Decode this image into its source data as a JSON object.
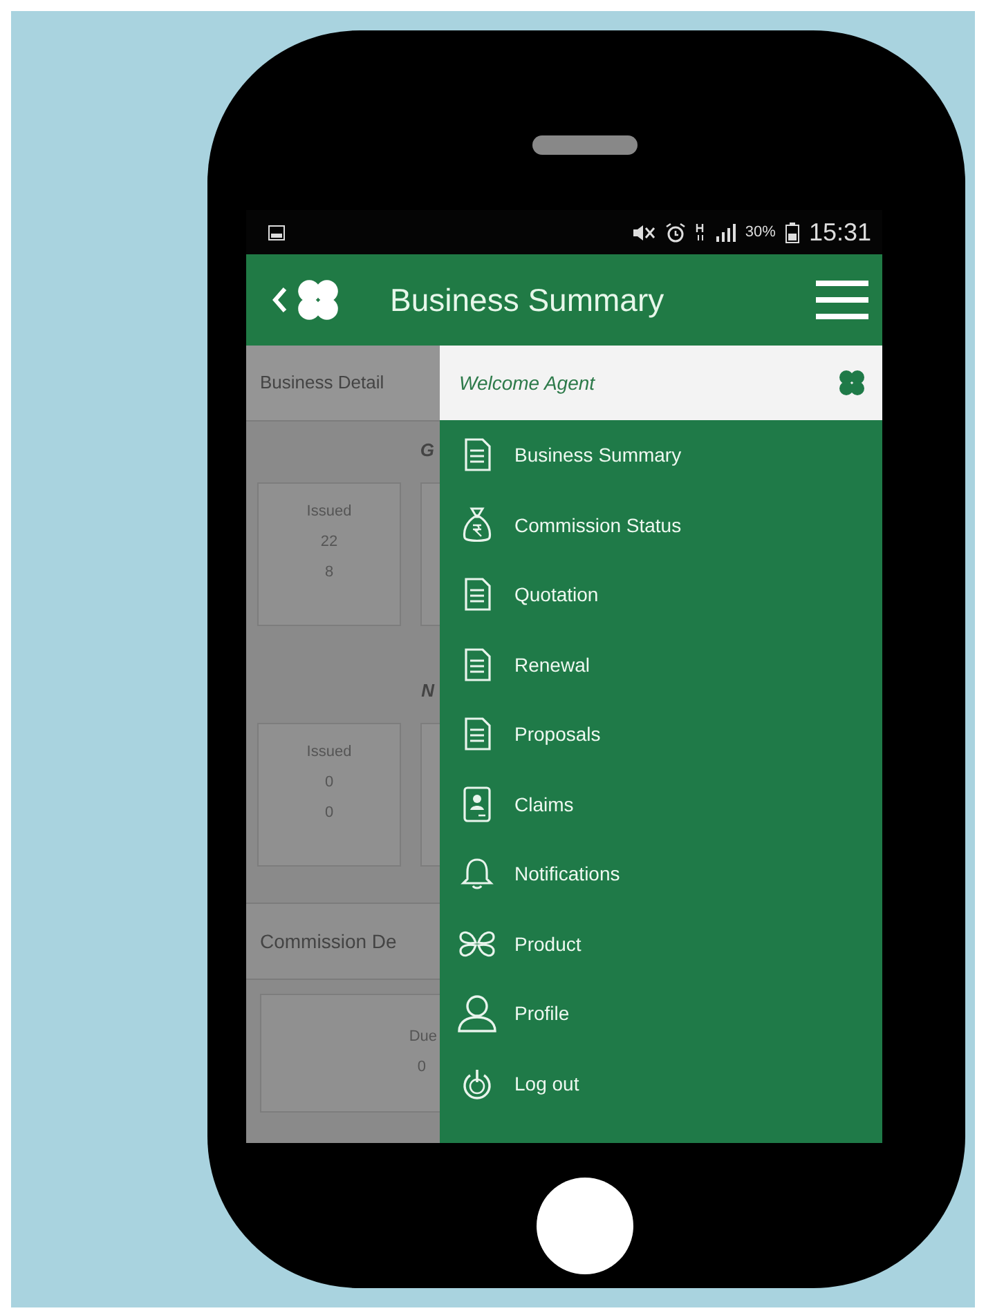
{
  "status_bar": {
    "battery": "30%",
    "time": "15:31"
  },
  "header": {
    "title": "Business Summary"
  },
  "background_screen": {
    "section_title": "Business Detail",
    "groups": [
      {
        "heading": "G",
        "card": {
          "label": "Issued",
          "values": [
            "22",
            "8"
          ]
        }
      },
      {
        "heading": "N",
        "card": {
          "label": "Issued",
          "values": [
            "0",
            "0"
          ]
        }
      }
    ],
    "commission": {
      "title": "Commission De",
      "label": "Due",
      "value": "0"
    }
  },
  "drawer": {
    "greeting": "Welcome Agent",
    "items": [
      {
        "label": "Business Summary",
        "kind": "document"
      },
      {
        "label": "Commission Status",
        "kind": "money-bag"
      },
      {
        "label": "Quotation",
        "kind": "document"
      },
      {
        "label": "Renewal",
        "kind": "document"
      },
      {
        "label": "Proposals",
        "kind": "document"
      },
      {
        "label": "Claims",
        "kind": "id-card"
      },
      {
        "label": "Notifications",
        "kind": "bell"
      },
      {
        "label": "Product",
        "kind": "clover"
      },
      {
        "label": "Profile",
        "kind": "person"
      },
      {
        "label": "Log out",
        "kind": "power"
      }
    ]
  }
}
